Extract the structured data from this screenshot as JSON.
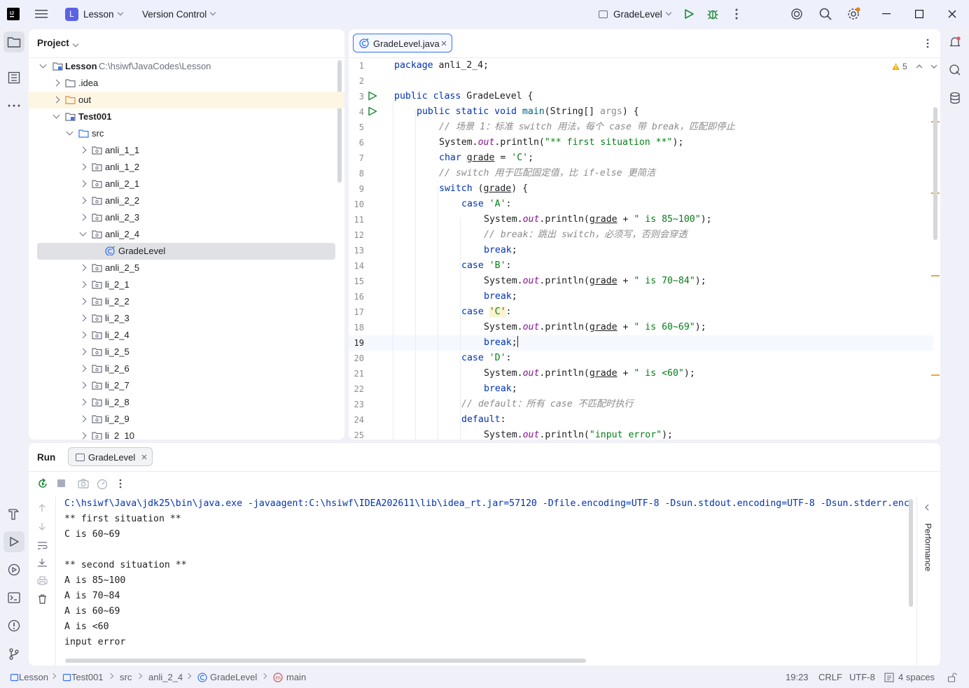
{
  "titlebar": {
    "project_badge": "L",
    "project_name": "Lesson",
    "vcs": "Version Control",
    "run_config": "GradeLevel"
  },
  "project_panel": {
    "title": "Project",
    "root": {
      "name": "Lesson",
      "path": "C:\\hsiwf\\JavaCodes\\Lesson"
    },
    "items": [
      {
        "label": ".idea"
      },
      {
        "label": "out"
      },
      {
        "label": "Test001"
      },
      {
        "label": "src"
      },
      {
        "label": "anli_1_1"
      },
      {
        "label": "anli_1_2"
      },
      {
        "label": "anli_2_1"
      },
      {
        "label": "anli_2_2"
      },
      {
        "label": "anli_2_3"
      },
      {
        "label": "anli_2_4"
      },
      {
        "label": "GradeLevel"
      },
      {
        "label": "anli_2_5"
      },
      {
        "label": "li_2_1"
      },
      {
        "label": "li_2_2"
      },
      {
        "label": "li_2_3"
      },
      {
        "label": "li_2_4"
      },
      {
        "label": "li_2_5"
      },
      {
        "label": "li_2_6"
      },
      {
        "label": "li_2_7"
      },
      {
        "label": "li_2_8"
      },
      {
        "label": "li_2_9"
      },
      {
        "label": "li_2_10"
      }
    ]
  },
  "editor": {
    "tab": "GradeLevel.java",
    "warnings": "5",
    "line_numbers": [
      "1",
      "2",
      "3",
      "4",
      "5",
      "6",
      "7",
      "8",
      "9",
      "10",
      "11",
      "12",
      "13",
      "14",
      "15",
      "16",
      "17",
      "18",
      "19",
      "20",
      "21",
      "22",
      "23",
      "24",
      "25"
    ],
    "tokens": {
      "l1a": "package",
      "l1b": " anli_2_4;",
      "l3a": "public class",
      "l3b": " GradeLevel {",
      "l4a": "public static void",
      "l4b": "main",
      "l4c": "(String[] ",
      "l4d": "args",
      "l4e": ") {",
      "l5": "// 场景 1：标准 switch 用法，每个 case 带 break，匹配即停止",
      "l6a": "System.",
      "l6b": "out",
      "l6c": ".println(",
      "l6d": "\"** first situation **\"",
      "l6e": ");",
      "l7a": "char ",
      "l7b": "grade",
      "l7c": " = ",
      "l7d": "'C'",
      "l7e": ";",
      "l8": "// switch 用于匹配固定值，比 if-else 更简洁",
      "l9a": "switch",
      "l9b": " (",
      "l9c": "grade",
      "l9d": ") {",
      "l10a": "case ",
      "l10b": "'A'",
      "l10c": ":",
      "l11a": "System.",
      "l11b": "out",
      "l11c": ".println(",
      "l11d": "grade",
      "l11e": " + ",
      "l11f": "\" is 85~100\"",
      "l11g": ");",
      "l12": "// break：跳出 switch，必须写，否则会穿透",
      "l13": "break",
      "semi": ";",
      "l14a": "case ",
      "l14b": "'B'",
      "l14c": ":",
      "l15f": "\" is 70~84\"",
      "l17b": "'C'",
      "l18f": "\" is 60~69\"",
      "l20b": "'D'",
      "l21f": "\" is <60\"",
      "l23": "// default：所有 case 不匹配时执行",
      "l24": "default",
      "l24b": ":",
      "l25f": "\"input error\""
    }
  },
  "run_panel": {
    "title": "Run",
    "tab": "GradeLevel",
    "side_tab": "Performance",
    "output": [
      "C:\\hsiwf\\Java\\jdk25\\bin\\java.exe -javaagent:C:\\hsiwf\\IDEA202611\\lib\\idea_rt.jar=57120 -Dfile.encoding=UTF-8 -Dsun.stdout.encoding=UTF-8 -Dsun.stderr.enc",
      "** first situation **",
      "C is 60~69",
      "",
      "** second situation **",
      "A is 85~100",
      "A is 70~84",
      "A is 60~69",
      "A is <60",
      "input error"
    ]
  },
  "statusbar": {
    "crumbs": [
      "Lesson",
      "Test001",
      "src",
      "anli_2_4",
      "GradeLevel",
      "main"
    ],
    "position": "19:23",
    "line_sep": "CRLF",
    "encoding": "UTF-8",
    "indent": "4 spaces"
  },
  "colors": {
    "accent": "#3574f0",
    "keyword": "#0033b3",
    "string": "#067d17",
    "run_green": "#208a3c"
  }
}
